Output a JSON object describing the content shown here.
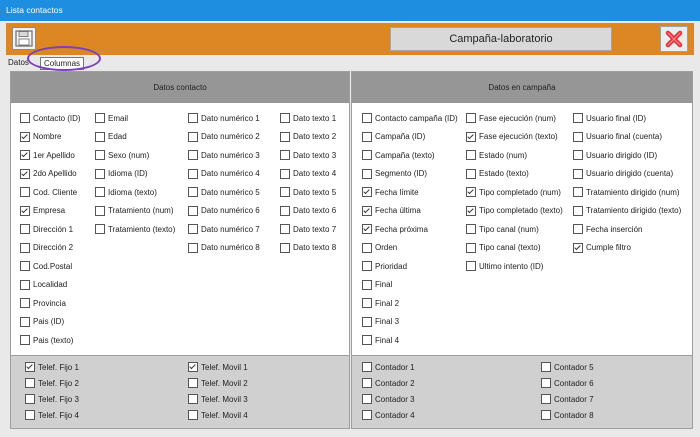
{
  "window": {
    "title": "Lista contactos"
  },
  "toolbar": {
    "campaign": "Campaña-laboratorio",
    "save_icon": "floppy-disk-icon",
    "close_icon": "close-x-icon",
    "close_color": "#e0303a"
  },
  "tabs": {
    "datos": "Datos",
    "columnas": "Columnas"
  },
  "left": {
    "header": "Datos contacto",
    "cols": [
      [
        {
          "label": "Contacto (ID)",
          "checked": false
        },
        {
          "label": "Nombre",
          "checked": true
        },
        {
          "label": "1er Apellido",
          "checked": true
        },
        {
          "label": "2do Apellido",
          "checked": true
        },
        {
          "label": "Cod. Cliente",
          "checked": false
        },
        {
          "label": "Empresa",
          "checked": true
        },
        {
          "label": "Dirección 1",
          "checked": false
        },
        {
          "label": "Dirección 2",
          "checked": false
        },
        {
          "label": "Cod.Postal",
          "checked": false
        },
        {
          "label": "Localidad",
          "checked": false
        },
        {
          "label": "Provincia",
          "checked": false
        },
        {
          "label": "Pais (ID)",
          "checked": false
        },
        {
          "label": "Pais (texto)",
          "checked": false
        }
      ],
      [
        {
          "label": "Email",
          "checked": false
        },
        {
          "label": "Edad",
          "checked": false
        },
        {
          "label": "Sexo (num)",
          "checked": false
        },
        {
          "label": "Idioma (ID)",
          "checked": false
        },
        {
          "label": "Idioma (texto)",
          "checked": false
        },
        {
          "label": "Tratamiento (num)",
          "checked": false
        },
        {
          "label": "Tratamiento (texto)",
          "checked": false
        }
      ],
      [
        {
          "label": "Dato numérico 1",
          "checked": false
        },
        {
          "label": "Dato numérico 2",
          "checked": false
        },
        {
          "label": "Dato numérico 3",
          "checked": false
        },
        {
          "label": "Dato numérico 4",
          "checked": false
        },
        {
          "label": "Dato numérico 5",
          "checked": false
        },
        {
          "label": "Dato numérico 6",
          "checked": false
        },
        {
          "label": "Dato numérico 7",
          "checked": false
        },
        {
          "label": "Dato numérico 8",
          "checked": false
        }
      ],
      [
        {
          "label": "Dato texto 1",
          "checked": false
        },
        {
          "label": "Dato texto 2",
          "checked": false
        },
        {
          "label": "Dato texto 3",
          "checked": false
        },
        {
          "label": "Dato texto 4",
          "checked": false
        },
        {
          "label": "Dato texto 5",
          "checked": false
        },
        {
          "label": "Dato texto 6",
          "checked": false
        },
        {
          "label": "Dato texto 7",
          "checked": false
        },
        {
          "label": "Dato texto 8",
          "checked": false
        }
      ]
    ],
    "footer": [
      [
        {
          "label": "Telef. Fijo 1",
          "checked": true
        },
        {
          "label": "Telef. Fijo 2",
          "checked": false
        },
        {
          "label": "Telef. Fijo 3",
          "checked": false
        },
        {
          "label": "Telef. Fijo 4",
          "checked": false
        }
      ],
      [
        {
          "label": "Telef. Movil 1",
          "checked": true
        },
        {
          "label": "Telef. Movil 2",
          "checked": false
        },
        {
          "label": "Telef. Movil 3",
          "checked": false
        },
        {
          "label": "Telef. Movil 4",
          "checked": false
        }
      ]
    ]
  },
  "right": {
    "header": "Datos en campaña",
    "cols": [
      [
        {
          "label": "Contacto campaña (ID)",
          "checked": false
        },
        {
          "label": "Campaña (ID)",
          "checked": false
        },
        {
          "label": "Campaña (texto)",
          "checked": false
        },
        {
          "label": "Segmento (ID)",
          "checked": false
        },
        {
          "label": "Fecha límite",
          "checked": true
        },
        {
          "label": "Fecha última",
          "checked": true
        },
        {
          "label": "Fecha próxima",
          "checked": true
        },
        {
          "label": "Orden",
          "checked": false
        },
        {
          "label": "Prioridad",
          "checked": false
        },
        {
          "label": "Final",
          "checked": false
        },
        {
          "label": "Final 2",
          "checked": false
        },
        {
          "label": "Final 3",
          "checked": false
        },
        {
          "label": "Final 4",
          "checked": false
        }
      ],
      [
        {
          "label": "Fase ejecución (num)",
          "checked": false
        },
        {
          "label": "Fase ejecución (texto)",
          "checked": true
        },
        {
          "label": "Estado (num)",
          "checked": false
        },
        {
          "label": "Estado (texto)",
          "checked": false
        },
        {
          "label": "Tipo completado (num)",
          "checked": true
        },
        {
          "label": "Tipo completado (texto)",
          "checked": true
        },
        {
          "label": "Tipo canal (num)",
          "checked": false
        },
        {
          "label": "Tipo canal (texto)",
          "checked": false
        },
        {
          "label": "Ultimo intento (ID)",
          "checked": false
        }
      ],
      [
        {
          "label": "Usuario final (ID)",
          "checked": false
        },
        {
          "label": "Usuario final (cuenta)",
          "checked": false
        },
        {
          "label": "Usuario dirigido (ID)",
          "checked": false
        },
        {
          "label": "Usuario dirigido (cuenta)",
          "checked": false
        },
        {
          "label": "Tratamiento dirigido (num)",
          "checked": false
        },
        {
          "label": "Tratamiento dirigido (texto)",
          "checked": false
        },
        {
          "label": "Fecha inserción",
          "checked": false
        },
        {
          "label": "Cumple filtro",
          "checked": true
        }
      ]
    ],
    "footer": [
      [
        {
          "label": "Contador 1",
          "checked": false
        },
        {
          "label": "Contador 2",
          "checked": false
        },
        {
          "label": "Contador 3",
          "checked": false
        },
        {
          "label": "Contador 4",
          "checked": false
        }
      ],
      [
        {
          "label": "Contador 5",
          "checked": false
        },
        {
          "label": "Contador 6",
          "checked": false
        },
        {
          "label": "Contador 7",
          "checked": false
        },
        {
          "label": "Contador 8",
          "checked": false
        }
      ]
    ]
  }
}
